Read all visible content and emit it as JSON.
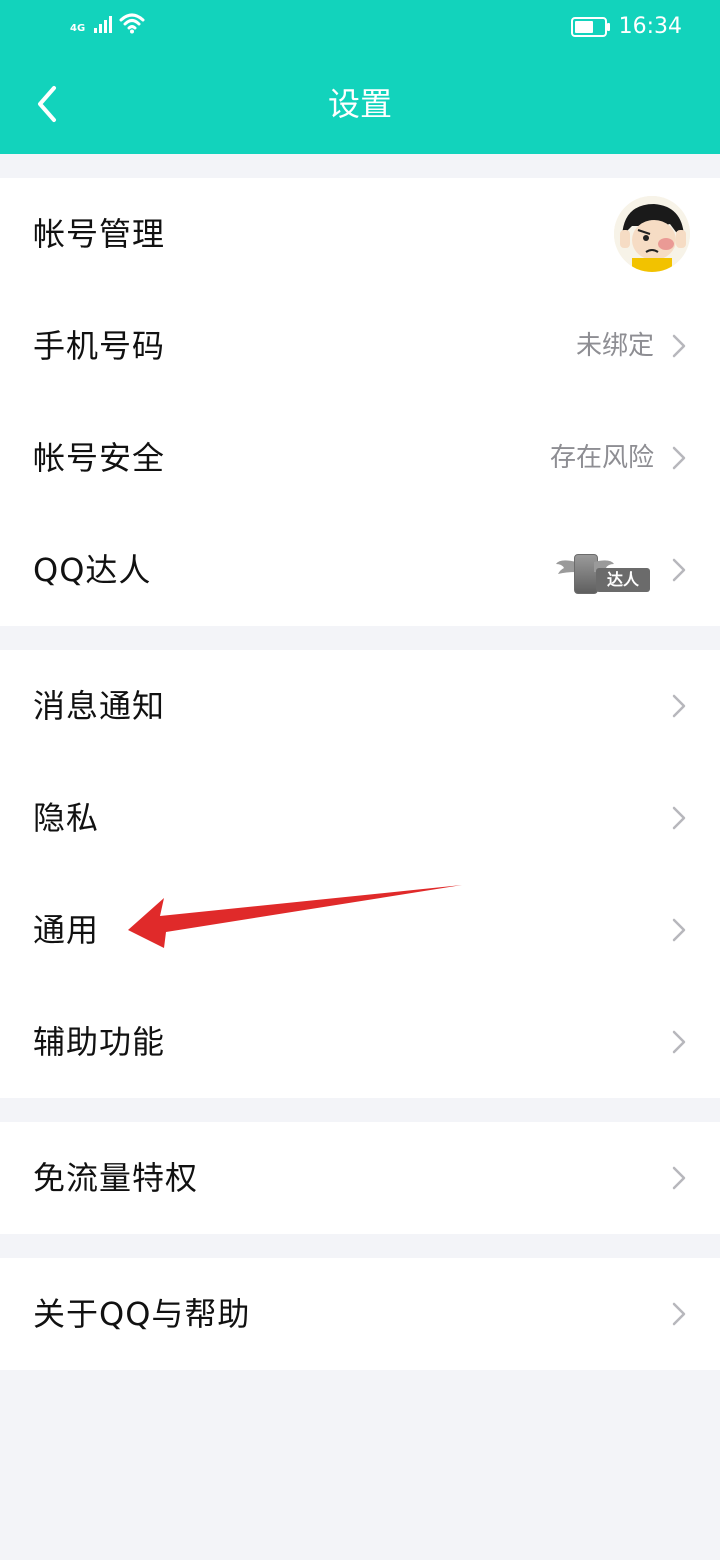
{
  "status_bar": {
    "network": "4G",
    "time": "16:34"
  },
  "header": {
    "title": "设置"
  },
  "groups": [
    {
      "items": [
        {
          "label": "帐号管理",
          "value": ""
        },
        {
          "label": "手机号码",
          "value": "未绑定"
        },
        {
          "label": "帐号安全",
          "value": "存在风险"
        },
        {
          "label": "QQ达人",
          "value": "",
          "badge": "达人"
        }
      ]
    },
    {
      "items": [
        {
          "label": "消息通知",
          "value": ""
        },
        {
          "label": "隐私",
          "value": ""
        },
        {
          "label": "通用",
          "value": ""
        },
        {
          "label": "辅助功能",
          "value": ""
        }
      ]
    },
    {
      "items": [
        {
          "label": "免流量特权",
          "value": ""
        }
      ]
    },
    {
      "items": [
        {
          "label": "关于QQ与帮助",
          "value": ""
        }
      ]
    }
  ],
  "colors": {
    "accent": "#12d3bc",
    "annotation_arrow": "#e02a2a",
    "page_bg": "#f3f4f8"
  },
  "icons": {
    "back": "chevron-left-icon",
    "row": "chevron-right-icon"
  }
}
